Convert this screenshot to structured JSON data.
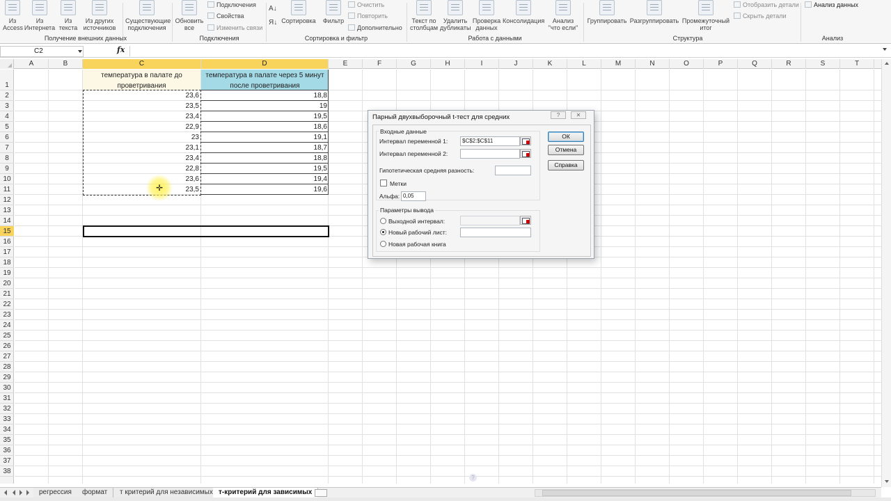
{
  "ribbon": {
    "groups": {
      "external_data": "Получение внешних данных",
      "connections": "Подключения",
      "sort_filter": "Сортировка и фильтр",
      "data_tools": "Работа с данными",
      "outline": "Структура",
      "analysis": "Анализ"
    },
    "buttons": {
      "from_access": [
        "Из",
        "Access"
      ],
      "from_web": [
        "Из",
        "Интернета"
      ],
      "from_text": [
        "Из",
        "текста"
      ],
      "from_other": [
        "Из других",
        "источников"
      ],
      "existing_conn": [
        "Существующие",
        "подключения"
      ],
      "refresh_all": [
        "Обновить",
        "все"
      ],
      "connections": "Подключения",
      "properties": "Свойства",
      "edit_links": "Изменить связи",
      "sort": "Сортировка",
      "filter": "Фильтр",
      "clear": "Очистить",
      "reapply": "Повторить",
      "advanced": "Дополнительно",
      "text_to_columns": [
        "Текст по",
        "столбцам"
      ],
      "remove_dup": [
        "Удалить",
        "дубликаты"
      ],
      "data_validation": [
        "Проверка",
        "данных"
      ],
      "consolidate": "Консолидация",
      "what_if": [
        "Анализ",
        "\"что если\""
      ],
      "group": "Группировать",
      "ungroup": "Разгруппировать",
      "subtotal": [
        "Промежуточный",
        "итог"
      ],
      "show_detail": "Отобразить детали",
      "hide_detail": "Скрыть детали",
      "data_analysis": "Анализ данных"
    }
  },
  "formula_bar": {
    "name_box": "C2",
    "fx": "fx",
    "formula": ""
  },
  "sheet": {
    "columns": [
      "A",
      "B",
      "C",
      "D",
      "E",
      "F",
      "G",
      "H",
      "I",
      "J",
      "K",
      "L",
      "M",
      "N",
      "O",
      "P",
      "Q",
      "R",
      "S",
      "T"
    ],
    "rows": [
      "1",
      "2",
      "3",
      "4",
      "5",
      "6",
      "7",
      "8",
      "9",
      "10",
      "11",
      "12",
      "13",
      "14",
      "15",
      "16",
      "17",
      "18",
      "19",
      "20",
      "21",
      "22",
      "23",
      "24",
      "25",
      "26",
      "27",
      "28",
      "29",
      "30",
      "31",
      "32",
      "33",
      "34",
      "35",
      "36",
      "37",
      "38"
    ],
    "header_c": "температура в палате до проветривания",
    "header_d": "температура в палате через 5 минут после проветривания",
    "col_c": [
      "23,6",
      "23,5",
      "23,4",
      "22,9",
      "23",
      "23,1",
      "23,4",
      "22,8",
      "23,6",
      "23,5"
    ],
    "col_d": [
      "18,8",
      "19",
      "19,5",
      "18,6",
      "19,1",
      "18,7",
      "18,8",
      "19,5",
      "19,4",
      "19,6"
    ]
  },
  "tabs": [
    {
      "label": "регрессия",
      "active": false
    },
    {
      "label": "формат",
      "active": false
    },
    {
      "label": "т критерий для независимых",
      "active": false
    },
    {
      "label": "т-критерий для зависимых",
      "active": true
    }
  ],
  "dialog": {
    "title": "Парный двухвыборочный t-тест для средних",
    "input_group": "Входные данные",
    "var1_label": "Интервал переменной 1:",
    "var1_value": "$C$2:$C$11",
    "var2_label": "Интервал переменной 2:",
    "var2_value": "",
    "hyp_label": "Гипотетическая средняя разность:",
    "hyp_value": "",
    "labels_checkbox": "Метки",
    "alpha_label": "Альфа:",
    "alpha_value": "0,05",
    "output_group": "Параметры вывода",
    "output_range": "Выходной интервал:",
    "new_sheet": "Новый рабочий лист:",
    "new_book": "Новая рабочая книга",
    "selected_output": "new_sheet",
    "ok": "ОК",
    "cancel": "Отмена",
    "help": "Справка"
  },
  "colors": {
    "header_c_fill": "#fdf8e6",
    "header_d_fill": "#a4d9e6",
    "selected_header": "#f9d45c"
  }
}
